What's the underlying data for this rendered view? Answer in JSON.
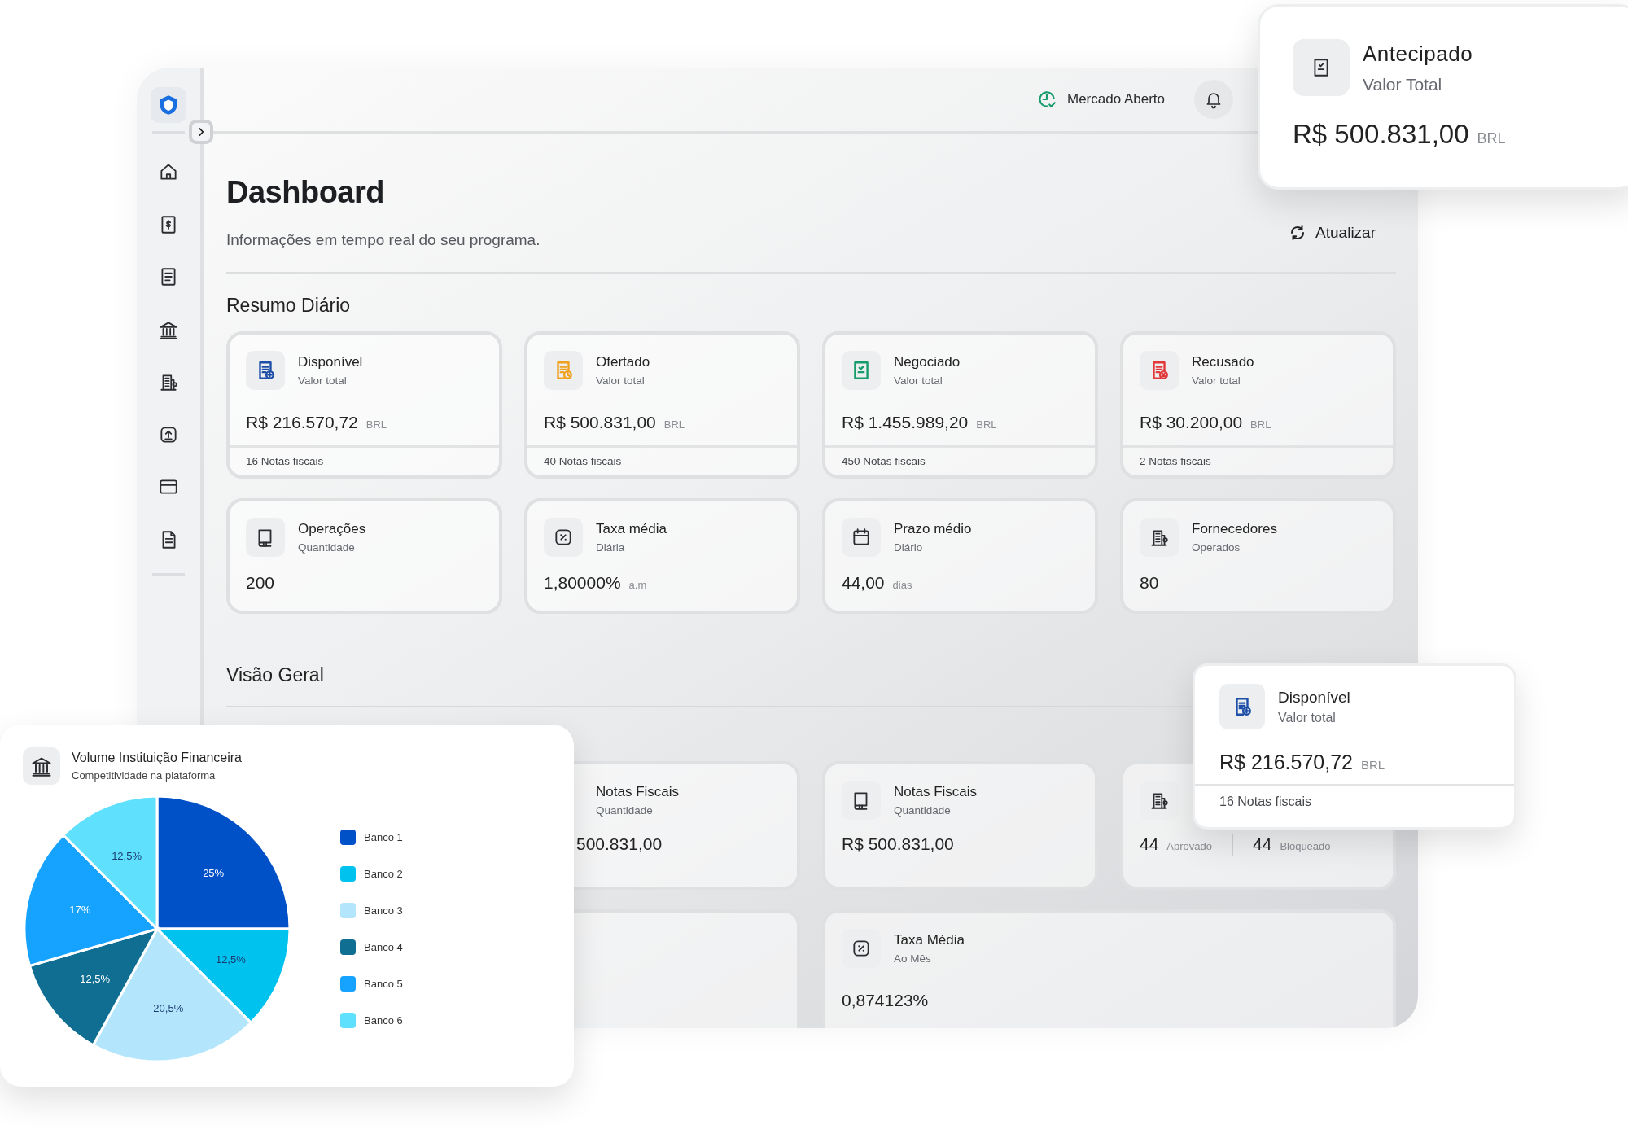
{
  "header": {
    "status": "Mercado Aberto"
  },
  "page": {
    "title": "Dashboard",
    "subtitle": "Informações em tempo real do seu programa.",
    "refresh": "Atualizar"
  },
  "summary": {
    "title": "Resumo Diário",
    "cards": [
      {
        "color": "#1e4fa8",
        "title": "Disponível",
        "subtitle": "Valor total",
        "value": "R$ 216.570,72",
        "unit": "BRL",
        "footer": "16 Notas fiscais"
      },
      {
        "color": "#f0a11e",
        "title": "Ofertado",
        "subtitle": "Valor total",
        "value": "R$ 500.831,00",
        "unit": "BRL",
        "footer": "40 Notas fiscais"
      },
      {
        "color": "#169b6b",
        "title": "Negociado",
        "subtitle": "Valor total",
        "value": "R$ 1.455.989,20",
        "unit": "BRL",
        "footer": "450 Notas fiscais"
      },
      {
        "color": "#e2383a",
        "title": "Recusado",
        "subtitle": "Valor total",
        "value": "R$ 30.200,00",
        "unit": "BRL",
        "footer": "2 Notas fiscais"
      },
      {
        "title": "Operações",
        "subtitle": "Quantidade",
        "value": "200"
      },
      {
        "title": "Taxa média",
        "subtitle": "Diária",
        "value": "1,80000%",
        "unit": "a.m"
      },
      {
        "title": "Prazo médio",
        "subtitle": "Diário",
        "value": "44,00",
        "unit": "dias"
      },
      {
        "title": "Fornecedores",
        "subtitle": "Operados",
        "value": "80"
      }
    ]
  },
  "overview": {
    "title": "Visão Geral",
    "rows": [
      [
        {
          "kind": "stat",
          "title": "Notas Fiscais",
          "subtitle": "Quantidade",
          "value": "500.831,00"
        },
        {
          "kind": "stat",
          "title": "Notas Fiscais",
          "subtitle": "Quantidade",
          "value": "R$ 500.831,00"
        },
        {
          "kind": "split",
          "values": [
            {
              "value": "44",
              "label": "Aprovado"
            },
            {
              "value": "44",
              "label": "Bloqueado"
            }
          ]
        }
      ],
      [
        {
          "kind": "empty"
        },
        {
          "kind": "wide",
          "title": "Taxa Média",
          "subtitle": "Ao Mês",
          "value": "0,874123%"
        }
      ]
    ]
  },
  "popup_top": {
    "title": "Antecipado",
    "subtitle": "Valor Total",
    "value": "R$ 500.831,00",
    "unit": "BRL"
  },
  "popup_side": {
    "color": "#1e4fa8",
    "title": "Disponível",
    "subtitle": "Valor total",
    "value": "R$ 216.570,72",
    "unit": "BRL",
    "footer": "16 Notas fiscais"
  },
  "chart_card": {
    "title": "Volume Instituição Financeira",
    "subtitle": "Competitividade na plataforma",
    "chart_data": {
      "type": "pie",
      "categories": [
        "Banco 1",
        "Banco 2",
        "Banco 3",
        "Banco 4",
        "Banco 5",
        "Banco 6"
      ],
      "series": [
        {
          "values": [
            25,
            12.5,
            20.5,
            12.5,
            17,
            12.5
          ]
        }
      ],
      "colors": [
        "#0050c8",
        "#00c2ee",
        "#b3e6fc",
        "#0f6e91",
        "#16a3ff",
        "#5fe0fc"
      ],
      "value_labels": [
        "25%",
        "12,5%",
        "20,5%",
        "12,5%",
        "17%",
        "12,5%"
      ]
    }
  }
}
